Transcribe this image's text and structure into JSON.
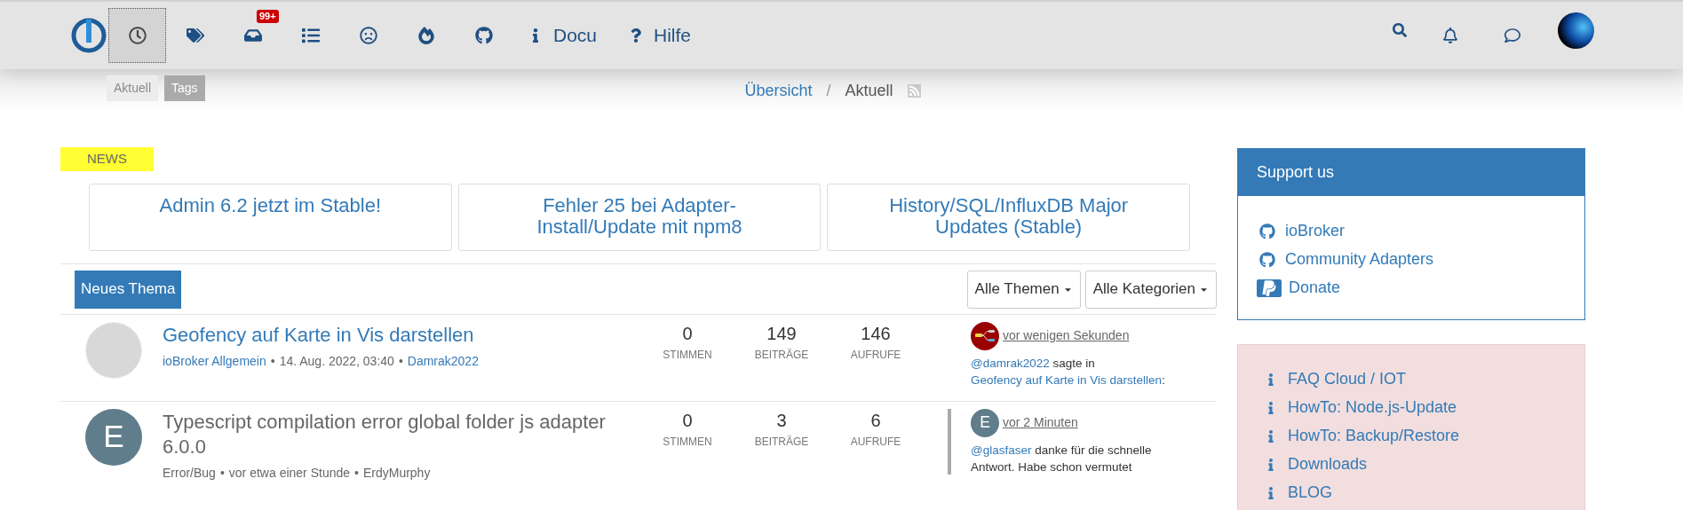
{
  "nav": {
    "items": [
      {
        "selected": true
      },
      {
        "selected": false
      },
      {
        "selected": false,
        "badge": "99+"
      },
      {
        "selected": false
      },
      {
        "selected": false
      },
      {
        "selected": false
      },
      {
        "selected": false
      },
      {
        "selected": false,
        "label": "Docu"
      },
      {
        "selected": false,
        "label": "Hilfe"
      }
    ],
    "tooltips": [
      {
        "text": "Aktuell",
        "faded": true
      },
      {
        "text": "Tags",
        "faded": false
      }
    ]
  },
  "breadcrumb": {
    "items": [
      {
        "label": "Übersicht",
        "link": true
      },
      {
        "label": "Aktuell",
        "link": false
      }
    ],
    "separator": "/"
  },
  "news": {
    "heading": "NEWS",
    "items": [
      "Admin 6.2 jetzt im Stable!",
      "Fehler 25 bei Adapter-Install/Update mit npm8",
      "History/SQL/InfluxDB Major Updates (Stable)"
    ]
  },
  "meta_separator": "•",
  "toolbar": {
    "new_topic": "Neues Thema",
    "filters": [
      "Alle Themen",
      "Alle Kategorien"
    ]
  },
  "topics": [
    {
      "title": "Geofency auf Karte in Vis darstellen",
      "unread": true,
      "avatar": {
        "kind": "photo"
      },
      "category": "ioBroker Allgemein",
      "time": "14. Aug. 2022, 03:40",
      "author": "Damrak2022",
      "stats": [
        {
          "value": "0",
          "label": "STIMMEN"
        },
        {
          "value": "149",
          "label": "BEITRÄGE"
        },
        {
          "value": "146",
          "label": "AUFRUFE"
        }
      ],
      "last_post": {
        "marker": false,
        "avatar": {
          "kind": "flow",
          "color": "#990000"
        },
        "time": "vor wenigen Sekunden",
        "parts": [
          {
            "text": "@damrak2022",
            "link": true
          },
          {
            "text": " sagte in ",
            "link": false
          },
          {
            "text": "Geofency auf Karte in Vis darstellen",
            "link": true
          },
          {
            "text": ":",
            "link": false
          }
        ]
      }
    },
    {
      "title": "Typescript compilation error global folder js adapter 6.0.0",
      "unread": false,
      "avatar": {
        "kind": "letter",
        "letter": "E",
        "color": "#607d8b"
      },
      "category": "Error/Bug",
      "time": "vor etwa einer Stunde",
      "author": "ErdyMurphy",
      "stats": [
        {
          "value": "0",
          "label": "STIMMEN"
        },
        {
          "value": "3",
          "label": "BEITRÄGE"
        },
        {
          "value": "6",
          "label": "AUFRUFE"
        }
      ],
      "last_post": {
        "marker": true,
        "avatar": {
          "kind": "letter",
          "letter": "E",
          "color": "#607d8b"
        },
        "time": "vor 2 Minuten",
        "parts": [
          {
            "text": "@glasfaser",
            "link": true
          },
          {
            "text": " danke für die schnelle Antwort. Habe schon vermutet",
            "link": false
          }
        ]
      }
    }
  ],
  "sidebar": {
    "support": {
      "title": "Support us",
      "links": [
        {
          "label": "ioBroker",
          "kind": "github"
        },
        {
          "label": "Community Adapters",
          "kind": "github"
        },
        {
          "label": "Donate",
          "kind": "paypal"
        }
      ]
    },
    "info_links": [
      "FAQ Cloud / IOT",
      "HowTo: Node.js-Update",
      "HowTo: Backup/Restore",
      "Downloads",
      "BLOG"
    ]
  }
}
